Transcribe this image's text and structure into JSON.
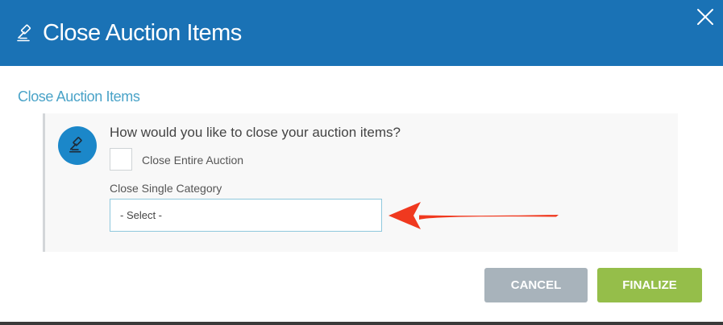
{
  "modal": {
    "header": {
      "icon": "gavel-icon",
      "title": "Close Auction Items",
      "close_icon": "close-icon"
    },
    "section_title": "Close Auction Items",
    "panel": {
      "icon": "gavel-icon",
      "question": "How would you like to close your auction items?",
      "close_entire_auction": {
        "label": "Close Entire Auction",
        "checked": false
      },
      "single_category": {
        "label": "Close Single Category",
        "selected": "- Select -"
      }
    },
    "buttons": {
      "cancel": "CANCEL",
      "finalize": "FINALIZE"
    }
  },
  "colors": {
    "header_bg": "#1a72b5",
    "section_title": "#4aa3c8",
    "icon_circle": "#1b87c9",
    "cancel_bg": "#a8b3bb",
    "finalize_bg": "#95be4a",
    "annotation_arrow": "#f0391f"
  }
}
